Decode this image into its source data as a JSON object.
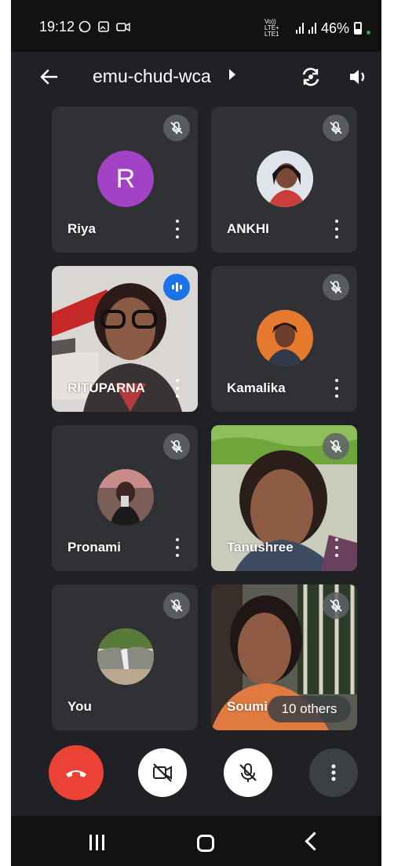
{
  "status": {
    "time": "19:12",
    "network": "Vo)) LTE+ LTE1",
    "battery": "46%"
  },
  "header": {
    "title": "emu-chud-wca",
    "back_icon": "arrow-left-icon",
    "flip_icon": "camera-flip-icon",
    "speaker_icon": "speaker-icon"
  },
  "participants": [
    {
      "name": "Riya",
      "initial": "R",
      "avatar_color": "#a142c4",
      "muted": true
    },
    {
      "name": "ANKHI",
      "muted": true
    },
    {
      "name": "RITUPARNA",
      "muted": false,
      "speaking": true
    },
    {
      "name": "Kamalika",
      "muted": true
    },
    {
      "name": "Pronami",
      "muted": true
    },
    {
      "name": "Tanushree",
      "muted": true
    },
    {
      "name": "You",
      "muted": true
    },
    {
      "name": "Soumi",
      "muted": true
    }
  ],
  "others_label": "10 others",
  "controls": {
    "hangup_icon": "phone-hangup-icon",
    "camera_icon": "camera-off-icon",
    "mic_icon": "mic-off-icon",
    "more_icon": "more-vertical-icon",
    "hangup_color": "#ea4335"
  },
  "colors": {
    "background": "#202124",
    "tile": "#303134",
    "accent": "#1a73e8"
  }
}
